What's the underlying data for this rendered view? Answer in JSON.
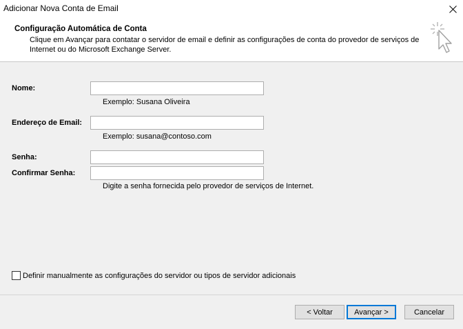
{
  "window": {
    "title": "Adicionar Nova Conta de Email",
    "close_glyph": "✕"
  },
  "header": {
    "title": "Configuração Automática de Conta",
    "description": "Clique em Avançar para contatar o servidor de email e definir as configurações de conta do provedor de serviços de Internet ou do Microsoft Exchange Server.",
    "icon": "wizard-cursor-icon"
  },
  "form": {
    "name": {
      "label": "Nome:",
      "value": "",
      "hint": "Exemplo: Susana Oliveira"
    },
    "email": {
      "label": "Endereço de Email:",
      "value": "",
      "hint": "Exemplo: susana@contoso.com"
    },
    "password": {
      "label": "Senha:",
      "value": ""
    },
    "confirm_password": {
      "label": "Confirmar Senha:",
      "value": "",
      "hint": "Digite a senha fornecida pelo provedor de serviços de Internet."
    }
  },
  "manual_setup": {
    "label": "Definir manualmente as configurações do servidor ou tipos de servidor adicionais",
    "checked": false
  },
  "buttons": {
    "back": "< Voltar",
    "next": "Avançar >",
    "cancel": "Cancelar"
  },
  "colors": {
    "primary_border": "#0078d7",
    "background": "#f0f0f0"
  }
}
